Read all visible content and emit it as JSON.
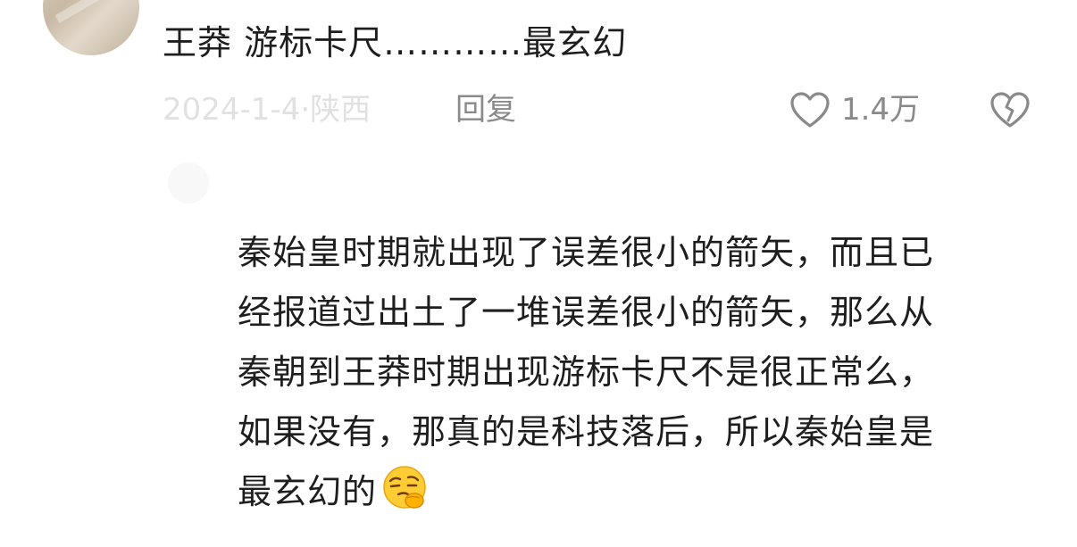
{
  "comment": {
    "text": "王莽  游标卡尺…………最玄幻",
    "date_location": "2024-1-4·陕西",
    "reply_label": "回复",
    "like_count": "1.4万",
    "like_icon": "heart-outline-icon",
    "dislike_icon": "broken-heart-icon"
  },
  "reply": {
    "lines": [
      "秦始皇时期就出现了误差很小的箭矢，而且已",
      "经报道过出土了一堆误差很小的箭矢，那么从",
      "秦朝到王莽时期出现游标卡尺不是很正常么，",
      "如果没有，那真的是科技落后，所以秦始皇是",
      "最玄幻的"
    ],
    "emoji": "thinking-face-emoji"
  }
}
